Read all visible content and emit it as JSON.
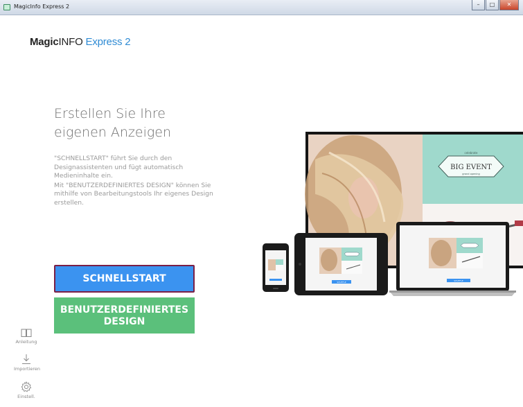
{
  "window": {
    "title": "MagicInfo Express 2",
    "controls": {
      "minimize": "–",
      "maximize": "□",
      "close": "✕"
    }
  },
  "logo": {
    "part1": "Magic",
    "part2": "INFO",
    "part3": "Express 2"
  },
  "main": {
    "headline_line1": "Erstellen Sie Ihre",
    "headline_line2": "eigenen Anzeigen",
    "desc_p1": "\"SCHNELLSTART\" führt Sie durch den Designassistenten und fügt automatisch Medieninhalte ein.",
    "desc_p2": "Mit \"BENUTZERDEFINIERTES DESIGN\" können Sie mithilfe von Bearbeitungstools Ihr eigenes Design erstellen."
  },
  "buttons": {
    "quickstart": "SCHNELLSTART",
    "custom_line1": "BENUTZERDEFINIERTES",
    "custom_line2": "DESIGN"
  },
  "sidebar": {
    "items": [
      {
        "label": "Anleitung",
        "icon": "book-icon"
      },
      {
        "label": "Importieren",
        "icon": "download-icon"
      },
      {
        "label": "Einstell.",
        "icon": "gear-icon"
      }
    ]
  },
  "illustration": {
    "sign_top": "celebrate",
    "sign_main": "BIG EVENT",
    "sign_bottom": "grand opening",
    "tablet_button": "SHUFFLE",
    "laptop_button": "SHUFFLE"
  },
  "colors": {
    "accent_blue": "#3b93f0",
    "accent_green": "#5bc07b",
    "focus_border": "#7a1f45",
    "logo_blue": "#2f8bd4"
  }
}
